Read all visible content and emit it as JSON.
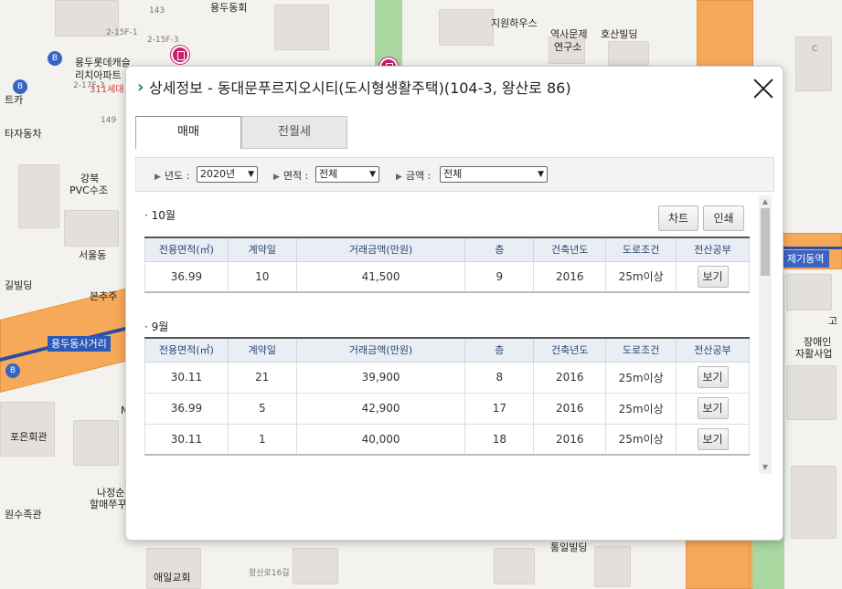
{
  "map": {
    "labels": [
      {
        "id": "yongdu-office",
        "text": "용두동회"
      },
      {
        "id": "jiwon-house",
        "text": "지원하우스"
      },
      {
        "id": "history-inst-1",
        "text": "역사문제"
      },
      {
        "id": "history-inst-2",
        "text": "연구소"
      },
      {
        "id": "hosan-bldg",
        "text": "호산빌딩"
      },
      {
        "id": "lotte-1",
        "text": "용두롯데캐슬"
      },
      {
        "id": "lotte-2",
        "text": "리치아파트"
      },
      {
        "id": "dong-311",
        "text": "311세대"
      },
      {
        "id": "teka",
        "text": "트카"
      },
      {
        "id": "tajadongcha",
        "text": "타자동차"
      },
      {
        "id": "gangbuk-1",
        "text": "강북"
      },
      {
        "id": "gangbuk-2",
        "text": "PVC수조"
      },
      {
        "id": "seoul-dong",
        "text": "서울동"
      },
      {
        "id": "gil-bldg",
        "text": "길빌딩"
      },
      {
        "id": "bonchu",
        "text": "본추주"
      },
      {
        "id": "sageori",
        "text": "용두동사거리"
      },
      {
        "id": "poeun",
        "text": "포은회관"
      },
      {
        "id": "najeong-1",
        "text": "나정순"
      },
      {
        "id": "najeong-2",
        "text": "할매쭈꾸"
      },
      {
        "id": "wonsujokgwan",
        "text": "원수족관"
      },
      {
        "id": "tongil",
        "text": "통일빌딩"
      },
      {
        "id": "aeil",
        "text": "애일교회"
      },
      {
        "id": "jegi",
        "text": "제기동역"
      },
      {
        "id": "jangaein-1",
        "text": "장애인"
      },
      {
        "id": "jangaein-2",
        "text": "자활사업"
      },
      {
        "id": "wangsan-16",
        "text": "왕산로16길"
      },
      {
        "id": "num-143",
        "text": "143"
      },
      {
        "id": "num-149",
        "text": "149"
      },
      {
        "id": "st-2-15f1",
        "text": "2-15F-1"
      },
      {
        "id": "st-2-15f3",
        "text": "2-15F-3"
      },
      {
        "id": "st-2-17f3",
        "text": "2-17F-3"
      },
      {
        "id": "c-letter",
        "text": "C"
      },
      {
        "id": "gi",
        "text": "고"
      },
      {
        "id": "n-letter",
        "text": "N"
      }
    ],
    "bus_icon_label": "B"
  },
  "modal": {
    "title_arrow": "›",
    "title": "상세정보 - 동대문푸르지오시티(도시형생활주택)(104-3, 왕산로 86)",
    "tabs": [
      {
        "label": "매매",
        "active": true
      },
      {
        "label": "전월세",
        "active": false
      }
    ],
    "filters": {
      "year_label": "년도 :",
      "year_value": "2020년",
      "area_label": "면적 :",
      "area_value": "전체",
      "price_label": "금액 :",
      "price_value": "전체",
      "bullet": "▶"
    },
    "buttons": {
      "chart": "차트",
      "print": "인쇄"
    },
    "columns": [
      "전용면적(㎡)",
      "계약일",
      "거래금액(만원)",
      "층",
      "건축년도",
      "도로조건",
      "전산공부"
    ],
    "sections": [
      {
        "month": "· 10월",
        "rows": [
          {
            "area": "36.99",
            "day": "10",
            "price": "41,500",
            "floor": "9",
            "year": "2016",
            "road": "25m이상",
            "action": "보기"
          }
        ]
      },
      {
        "month": "· 9월",
        "rows": [
          {
            "area": "30.11",
            "day": "21",
            "price": "39,900",
            "floor": "8",
            "year": "2016",
            "road": "25m이상",
            "action": "보기"
          },
          {
            "area": "36.99",
            "day": "5",
            "price": "42,900",
            "floor": "17",
            "year": "2016",
            "road": "25m이상",
            "action": "보기"
          },
          {
            "area": "30.11",
            "day": "1",
            "price": "40,000",
            "floor": "18",
            "year": "2016",
            "road": "25m이상",
            "action": "보기"
          }
        ]
      }
    ],
    "colors": {
      "accent_green": "#1e8a3c",
      "header_bg": "#e9eef5",
      "header_text": "#2a4370"
    }
  }
}
